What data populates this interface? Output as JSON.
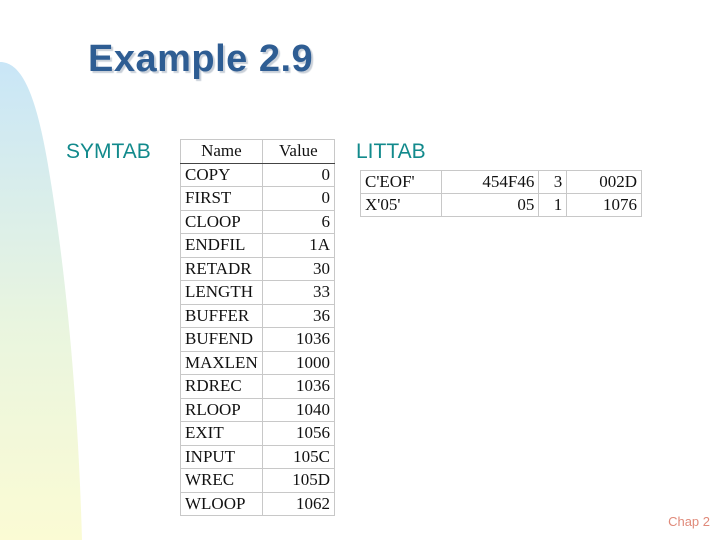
{
  "slide": {
    "title": "Example 2.9",
    "footer": "Chap 2",
    "colors": {
      "title": "#2e5d93",
      "label": "#128a8c",
      "footer": "#e08a7a"
    }
  },
  "symtab": {
    "label": "SYMTAB",
    "headers": [
      "Name",
      "Value"
    ],
    "rows": [
      {
        "name": "COPY",
        "value": "0"
      },
      {
        "name": "FIRST",
        "value": "0"
      },
      {
        "name": "CLOOP",
        "value": "6"
      },
      {
        "name": "ENDFIL",
        "value": "1A"
      },
      {
        "name": "RETADR",
        "value": "30"
      },
      {
        "name": "LENGTH",
        "value": "33"
      },
      {
        "name": "BUFFER",
        "value": "36"
      },
      {
        "name": "BUFEND",
        "value": "1036"
      },
      {
        "name": "MAXLEN",
        "value": "1000"
      },
      {
        "name": "RDREC",
        "value": "1036"
      },
      {
        "name": "RLOOP",
        "value": "1040"
      },
      {
        "name": "EXIT",
        "value": "1056"
      },
      {
        "name": "INPUT",
        "value": "105C"
      },
      {
        "name": "WREC",
        "value": "105D"
      },
      {
        "name": "WLOOP",
        "value": "1062"
      }
    ]
  },
  "littab": {
    "label": "LITTAB",
    "rows": [
      [
        "C'EOF'",
        "454F46",
        "3",
        "002D"
      ],
      [
        "X'05'",
        "05",
        "1",
        "1076"
      ]
    ]
  }
}
